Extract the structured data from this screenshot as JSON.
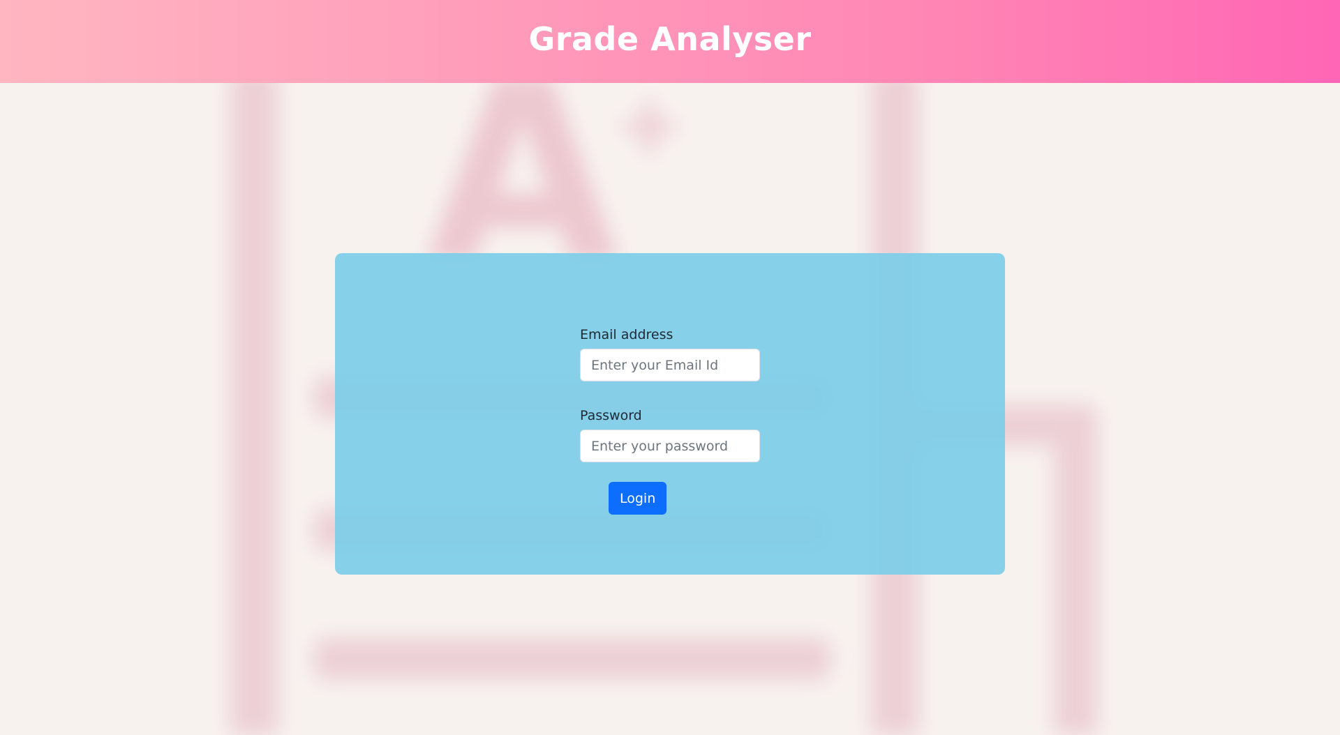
{
  "header": {
    "title": "Grade Analyser"
  },
  "background": {
    "grade_letter": "A",
    "grade_plus": "+"
  },
  "login_form": {
    "email_label": "Email address",
    "email_placeholder": "Enter your Email Id",
    "email_value": "",
    "password_label": "Password",
    "password_placeholder": "Enter your password",
    "password_value": "",
    "login_button_label": "Login"
  },
  "colors": {
    "header_gradient_start": "#ffb6c1",
    "header_gradient_end": "#ff66b5",
    "card_background": "#86d1e9",
    "page_background": "#f8f2ef",
    "button_primary": "#0d6efd"
  }
}
